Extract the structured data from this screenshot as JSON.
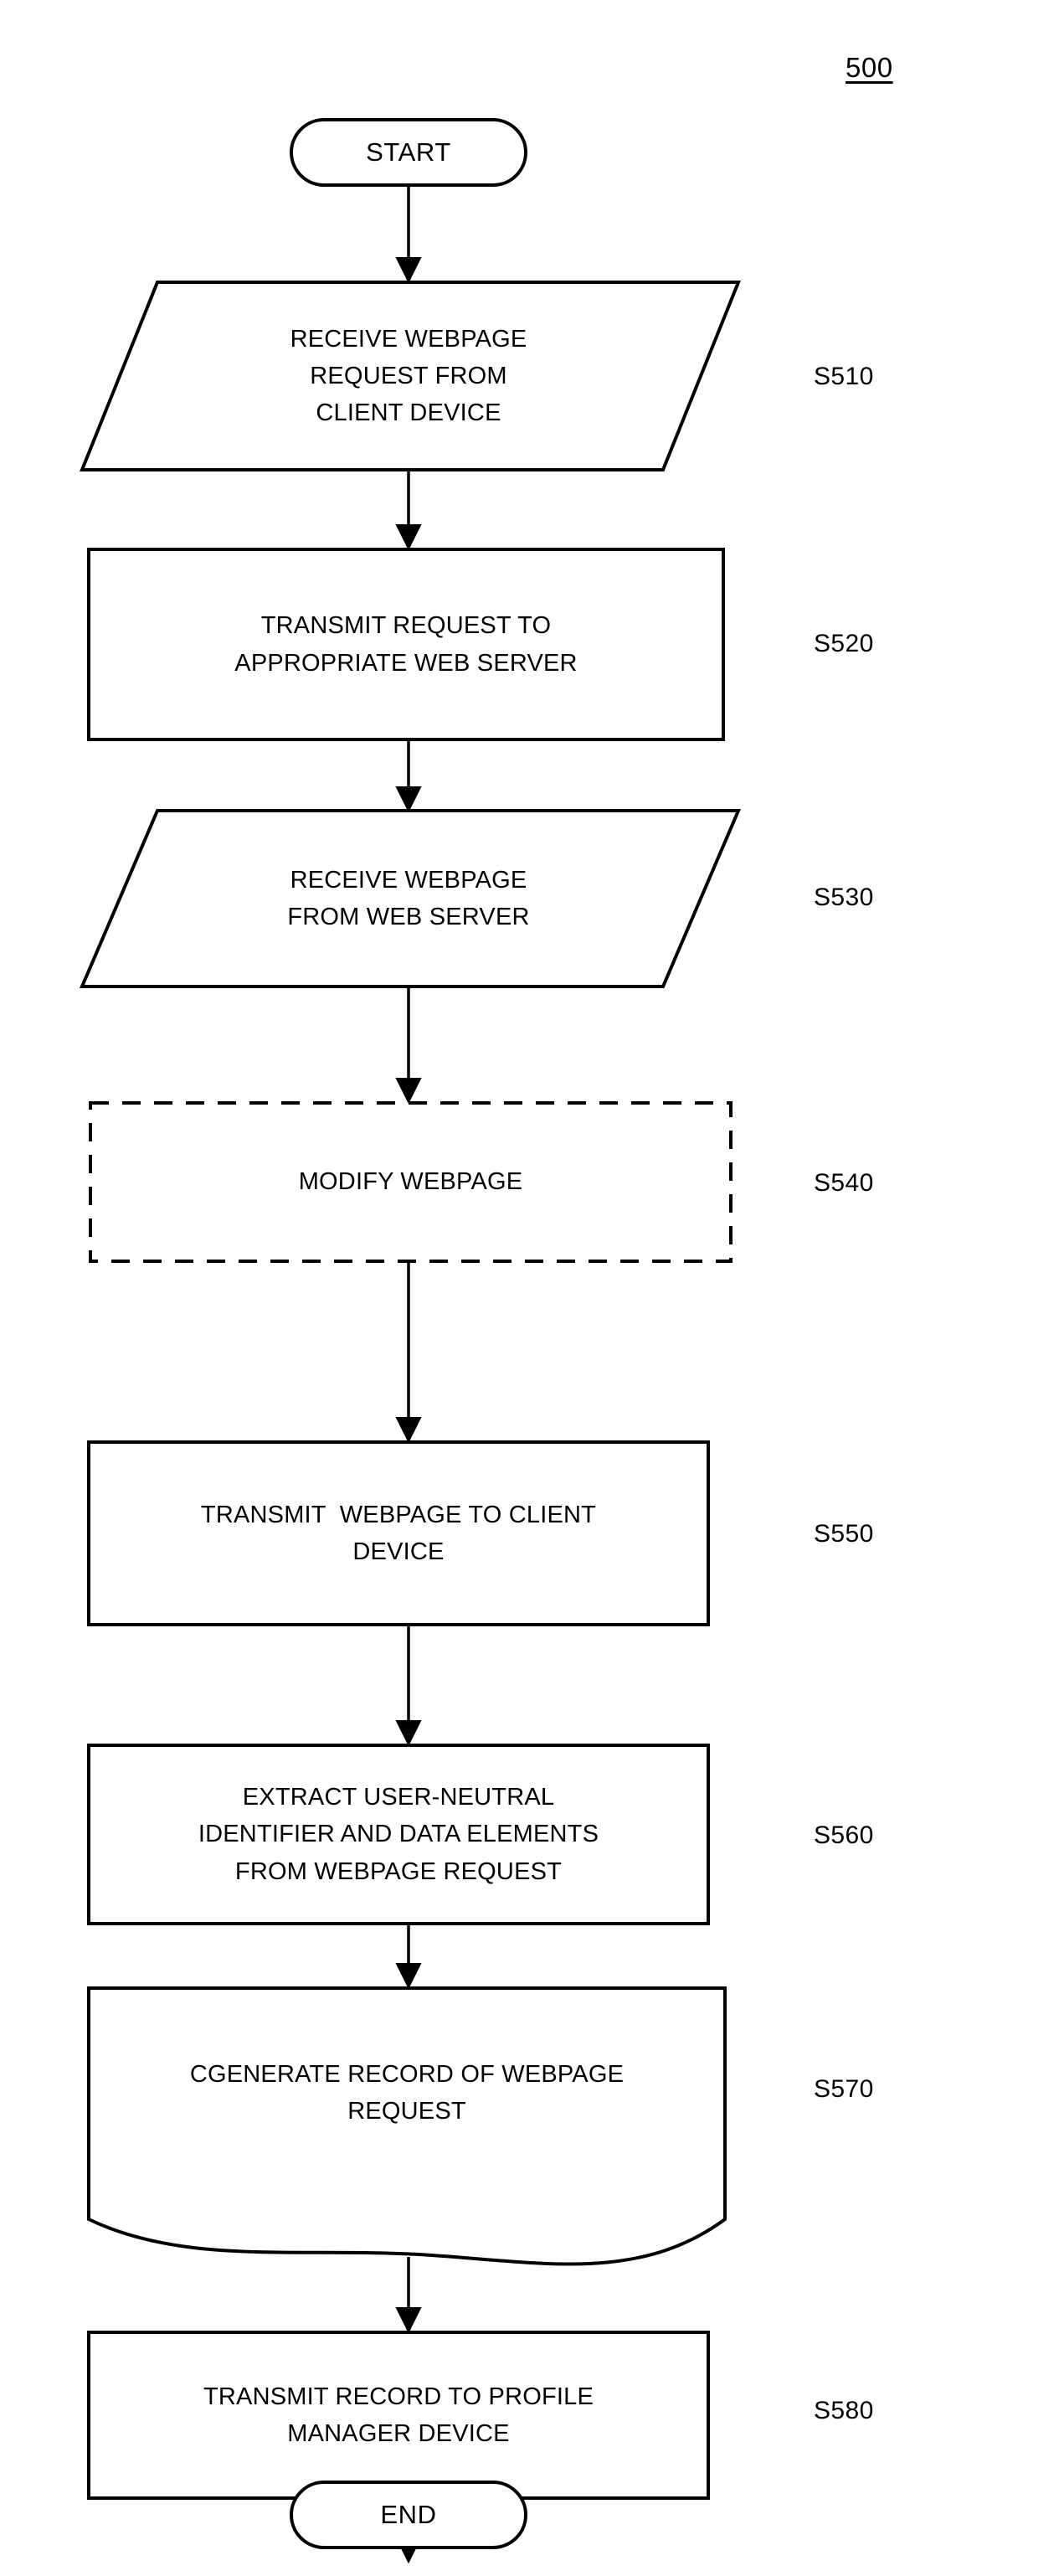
{
  "figure": {
    "number": "500"
  },
  "nodes": [
    {
      "id": "start",
      "shape": "terminal",
      "text": "START",
      "step": ""
    },
    {
      "id": "s510",
      "shape": "parallelogram",
      "text": "RECEIVE WEBPAGE\nREQUEST FROM\nCLIENT DEVICE",
      "step": "S510"
    },
    {
      "id": "s520",
      "shape": "rectangle",
      "text": "TRANSMIT REQUEST TO\nAPPROPRIATE WEB SERVER",
      "step": "S520"
    },
    {
      "id": "s530",
      "shape": "parallelogram",
      "text": "RECEIVE WEBPAGE\nFROM WEB SERVER",
      "step": "S530"
    },
    {
      "id": "s540",
      "shape": "dashed-rectangle",
      "text": "MODIFY WEBPAGE",
      "step": "S540"
    },
    {
      "id": "s550",
      "shape": "rectangle",
      "text": "TRANSMIT  WEBPAGE TO CLIENT\nDEVICE",
      "step": "S550"
    },
    {
      "id": "s560",
      "shape": "rectangle",
      "text": "EXTRACT USER-NEUTRAL\nIDENTIFIER AND DATA ELEMENTS\nFROM WEBPAGE REQUEST",
      "step": "S560"
    },
    {
      "id": "s570",
      "shape": "document",
      "text": "CGENERATE RECORD OF WEBPAGE\nREQUEST",
      "step": "S570"
    },
    {
      "id": "s580",
      "shape": "rectangle",
      "text": "TRANSMIT RECORD TO PROFILE\nMANAGER DEVICE",
      "step": "S580"
    },
    {
      "id": "end",
      "shape": "terminal",
      "text": "END",
      "step": ""
    }
  ],
  "colors": {
    "stroke": "#000000",
    "fill": "#ffffff",
    "text": "#000000"
  }
}
